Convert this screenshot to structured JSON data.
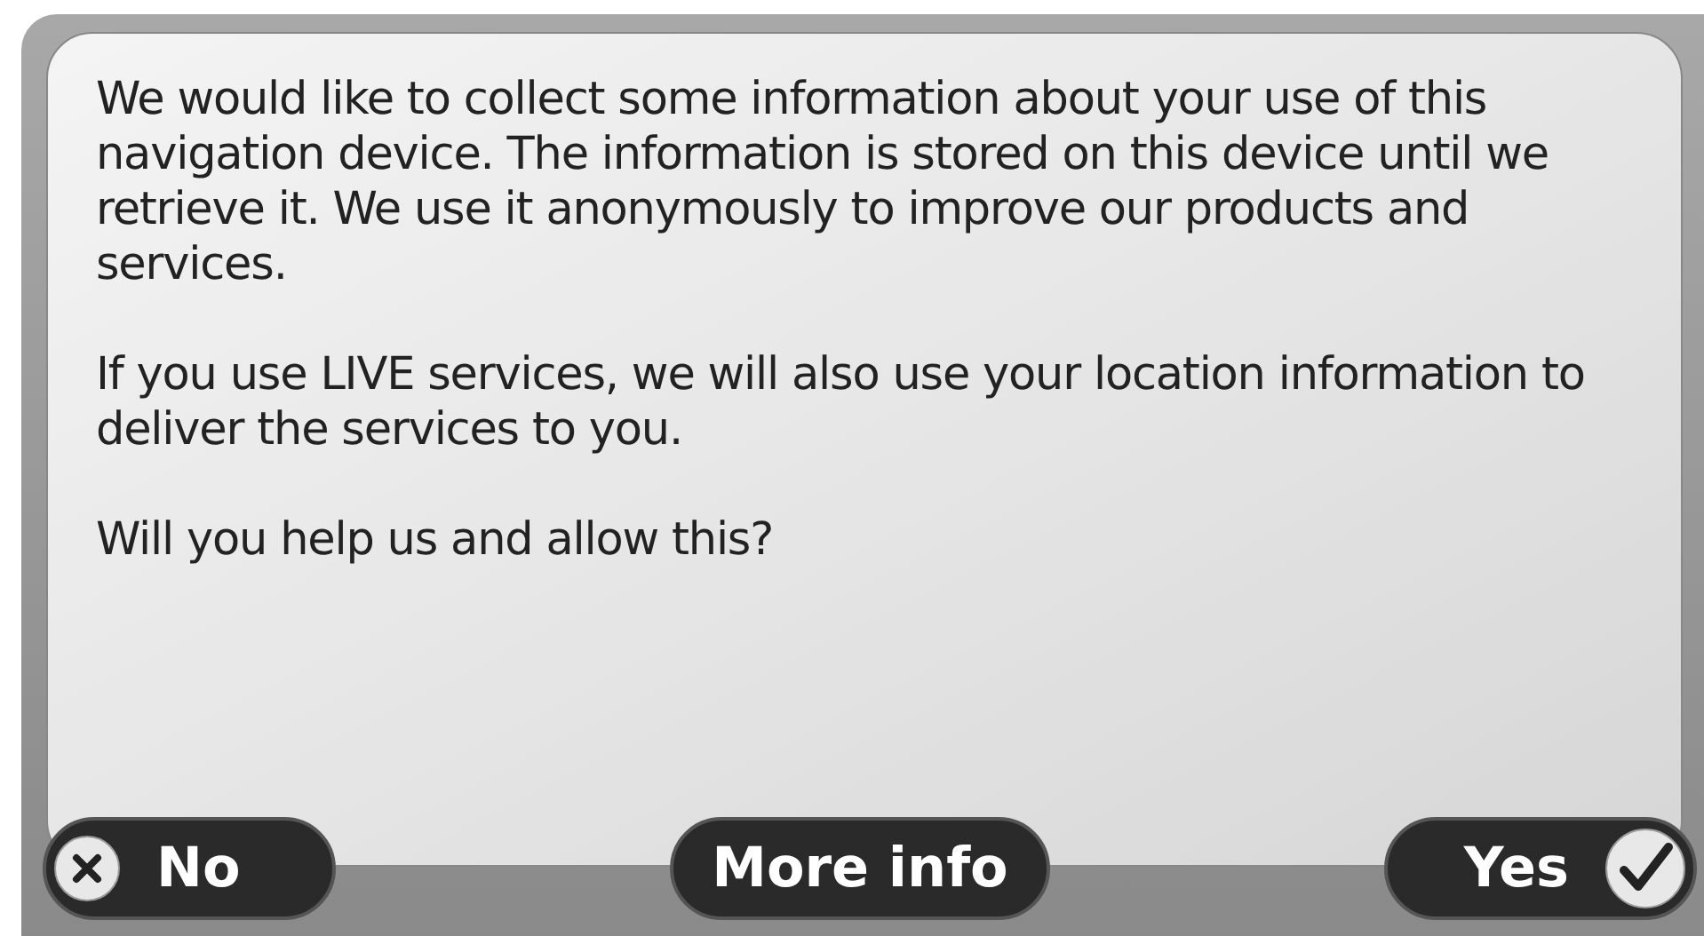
{
  "dialog": {
    "paragraphs": [
      "We would like to collect some information about your use of this navigation device. The information is stored on this device until we retrieve it. We use it anonymously to improve our products and services.",
      "If you use LIVE services, we will also use your location information to deliver the services to you.",
      "Will you help us and allow this?"
    ]
  },
  "buttons": [
    {
      "kind": "no",
      "label": "No"
    },
    {
      "kind": "info",
      "label": "More info"
    },
    {
      "kind": "yes",
      "label": "Yes"
    }
  ]
}
